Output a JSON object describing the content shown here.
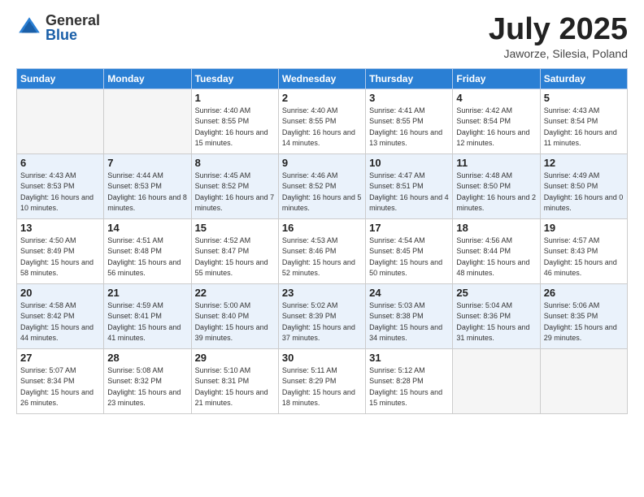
{
  "logo": {
    "general": "General",
    "blue": "Blue"
  },
  "title": {
    "month": "July 2025",
    "location": "Jaworze, Silesia, Poland"
  },
  "weekdays": [
    "Sunday",
    "Monday",
    "Tuesday",
    "Wednesday",
    "Thursday",
    "Friday",
    "Saturday"
  ],
  "weeks": [
    [
      {
        "day": "",
        "empty": true
      },
      {
        "day": "",
        "empty": true
      },
      {
        "day": "1",
        "sunrise": "4:40 AM",
        "sunset": "8:55 PM",
        "daylight": "16 hours and 15 minutes."
      },
      {
        "day": "2",
        "sunrise": "4:40 AM",
        "sunset": "8:55 PM",
        "daylight": "16 hours and 14 minutes."
      },
      {
        "day": "3",
        "sunrise": "4:41 AM",
        "sunset": "8:55 PM",
        "daylight": "16 hours and 13 minutes."
      },
      {
        "day": "4",
        "sunrise": "4:42 AM",
        "sunset": "8:54 PM",
        "daylight": "16 hours and 12 minutes."
      },
      {
        "day": "5",
        "sunrise": "4:43 AM",
        "sunset": "8:54 PM",
        "daylight": "16 hours and 11 minutes."
      }
    ],
    [
      {
        "day": "6",
        "sunrise": "4:43 AM",
        "sunset": "8:53 PM",
        "daylight": "16 hours and 10 minutes."
      },
      {
        "day": "7",
        "sunrise": "4:44 AM",
        "sunset": "8:53 PM",
        "daylight": "16 hours and 8 minutes."
      },
      {
        "day": "8",
        "sunrise": "4:45 AM",
        "sunset": "8:52 PM",
        "daylight": "16 hours and 7 minutes."
      },
      {
        "day": "9",
        "sunrise": "4:46 AM",
        "sunset": "8:52 PM",
        "daylight": "16 hours and 5 minutes."
      },
      {
        "day": "10",
        "sunrise": "4:47 AM",
        "sunset": "8:51 PM",
        "daylight": "16 hours and 4 minutes."
      },
      {
        "day": "11",
        "sunrise": "4:48 AM",
        "sunset": "8:50 PM",
        "daylight": "16 hours and 2 minutes."
      },
      {
        "day": "12",
        "sunrise": "4:49 AM",
        "sunset": "8:50 PM",
        "daylight": "16 hours and 0 minutes."
      }
    ],
    [
      {
        "day": "13",
        "sunrise": "4:50 AM",
        "sunset": "8:49 PM",
        "daylight": "15 hours and 58 minutes."
      },
      {
        "day": "14",
        "sunrise": "4:51 AM",
        "sunset": "8:48 PM",
        "daylight": "15 hours and 56 minutes."
      },
      {
        "day": "15",
        "sunrise": "4:52 AM",
        "sunset": "8:47 PM",
        "daylight": "15 hours and 55 minutes."
      },
      {
        "day": "16",
        "sunrise": "4:53 AM",
        "sunset": "8:46 PM",
        "daylight": "15 hours and 52 minutes."
      },
      {
        "day": "17",
        "sunrise": "4:54 AM",
        "sunset": "8:45 PM",
        "daylight": "15 hours and 50 minutes."
      },
      {
        "day": "18",
        "sunrise": "4:56 AM",
        "sunset": "8:44 PM",
        "daylight": "15 hours and 48 minutes."
      },
      {
        "day": "19",
        "sunrise": "4:57 AM",
        "sunset": "8:43 PM",
        "daylight": "15 hours and 46 minutes."
      }
    ],
    [
      {
        "day": "20",
        "sunrise": "4:58 AM",
        "sunset": "8:42 PM",
        "daylight": "15 hours and 44 minutes."
      },
      {
        "day": "21",
        "sunrise": "4:59 AM",
        "sunset": "8:41 PM",
        "daylight": "15 hours and 41 minutes."
      },
      {
        "day": "22",
        "sunrise": "5:00 AM",
        "sunset": "8:40 PM",
        "daylight": "15 hours and 39 minutes."
      },
      {
        "day": "23",
        "sunrise": "5:02 AM",
        "sunset": "8:39 PM",
        "daylight": "15 hours and 37 minutes."
      },
      {
        "day": "24",
        "sunrise": "5:03 AM",
        "sunset": "8:38 PM",
        "daylight": "15 hours and 34 minutes."
      },
      {
        "day": "25",
        "sunrise": "5:04 AM",
        "sunset": "8:36 PM",
        "daylight": "15 hours and 31 minutes."
      },
      {
        "day": "26",
        "sunrise": "5:06 AM",
        "sunset": "8:35 PM",
        "daylight": "15 hours and 29 minutes."
      }
    ],
    [
      {
        "day": "27",
        "sunrise": "5:07 AM",
        "sunset": "8:34 PM",
        "daylight": "15 hours and 26 minutes."
      },
      {
        "day": "28",
        "sunrise": "5:08 AM",
        "sunset": "8:32 PM",
        "daylight": "15 hours and 23 minutes."
      },
      {
        "day": "29",
        "sunrise": "5:10 AM",
        "sunset": "8:31 PM",
        "daylight": "15 hours and 21 minutes."
      },
      {
        "day": "30",
        "sunrise": "5:11 AM",
        "sunset": "8:29 PM",
        "daylight": "15 hours and 18 minutes."
      },
      {
        "day": "31",
        "sunrise": "5:12 AM",
        "sunset": "8:28 PM",
        "daylight": "15 hours and 15 minutes."
      },
      {
        "day": "",
        "empty": true
      },
      {
        "day": "",
        "empty": true
      }
    ]
  ]
}
